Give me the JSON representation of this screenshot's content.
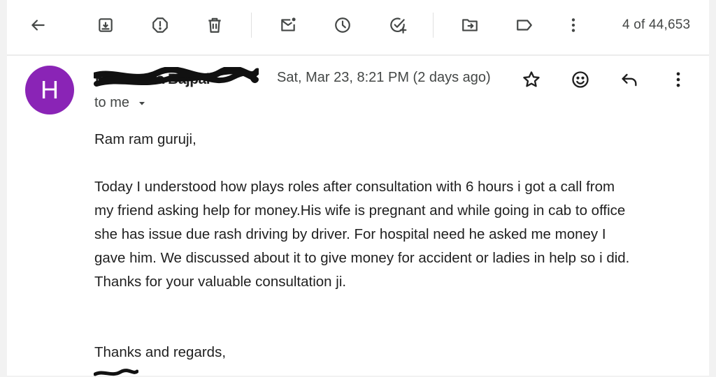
{
  "toolbar": {
    "back_icon": "arrow-left-icon",
    "archive_icon": "archive-icon",
    "report_spam_icon": "report-icon",
    "delete_icon": "trash-icon",
    "mark_unread_icon": "mail-unread-icon",
    "snooze_icon": "clock-icon",
    "add_task_icon": "add-task-icon",
    "move_to_icon": "move-to-folder-icon",
    "label_icon": "label-icon",
    "more_icon": "more-vert-icon",
    "counter": "4 of 44,653"
  },
  "message": {
    "avatar_letter": "H",
    "avatar_color": "#8a24b6",
    "sender_name": "Hemandra Bajpai",
    "date": "Sat, Mar 23, 8:21 PM (2 days ago)",
    "recipient": "to me",
    "star_icon": "star-icon",
    "emoji_icon": "emoji-icon",
    "reply_icon": "reply-icon",
    "more_icon": "more-vert-icon",
    "body": {
      "greeting": "Ram ram guruji,",
      "lines": [
        "Today I understood how plays roles after consultation with 6 hours i got a call from",
        "my friend asking help for money.His wife is pregnant and while going in cab to office",
        "she has issue due rash driving by driver. For hospital need he asked me money I",
        "gave him. We discussed about it to give money for accident or ladies in help so i did.",
        "Thanks for your valuable consultation ji."
      ],
      "signoff": "Thanks and regards,"
    }
  }
}
